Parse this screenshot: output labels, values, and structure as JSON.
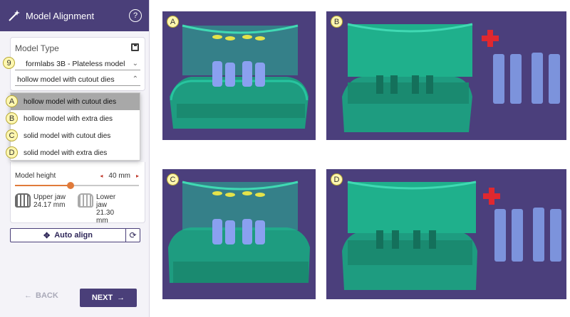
{
  "panel": {
    "title": "Model Alignment",
    "help": "?",
    "model_type_label": "Model Type",
    "printer_value": "formlabs 3B - Plateless model",
    "model_value": "hollow model with cutout dies",
    "badge_printer": "9",
    "dropdown": [
      {
        "badge": "A",
        "label": "hollow model with cutout dies",
        "selected": true
      },
      {
        "badge": "B",
        "label": "hollow model with extra dies",
        "selected": false
      },
      {
        "badge": "C",
        "label": "solid model with cutout dies",
        "selected": false
      },
      {
        "badge": "D",
        "label": "solid model with extra dies",
        "selected": false
      }
    ],
    "model_height_label": "Model height",
    "model_height_value": "40 mm",
    "model_height_fraction": 0.45,
    "upper_jaw_label": "Upper jaw",
    "upper_jaw_value": "24.17 mm",
    "lower_jaw_label": "Lower jaw",
    "lower_jaw_value": "21.30 mm",
    "auto_align_label": "Auto align",
    "back_label": "BACK",
    "next_label": "NEXT"
  },
  "images": [
    {
      "badge": "A",
      "variant": "hollow-cutout"
    },
    {
      "badge": "B",
      "variant": "hollow-extra"
    },
    {
      "badge": "C",
      "variant": "solid-cutout"
    },
    {
      "badge": "D",
      "variant": "solid-extra"
    }
  ],
  "colors": {
    "accent": "#4a3f79",
    "model": "#1fa889",
    "die": "#7c8fe0",
    "plus": "#e0282f",
    "background": "#4b3f7c"
  }
}
